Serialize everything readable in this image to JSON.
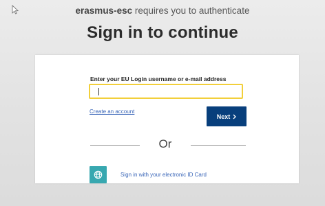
{
  "header": {
    "app_name": "erasmus-esc",
    "auth_message": " requires you to authenticate",
    "title": "Sign in to continue"
  },
  "login_form": {
    "field_label": "Enter your EU Login username or e-mail address",
    "username_value": "",
    "create_account_link": "Create an account",
    "next_button_label": "Next",
    "next_button_icon": "chevron-right-icon"
  },
  "alternative": {
    "or_text": "Or",
    "eid_link": "Sign in with your electronic ID Card",
    "eid_icon": "globe-icon"
  },
  "colors": {
    "next_button": "#083f7c",
    "input_focus_border": "#f2cf3a",
    "eid_icon_bg": "#38a8b0",
    "link": "#3a66b8"
  }
}
